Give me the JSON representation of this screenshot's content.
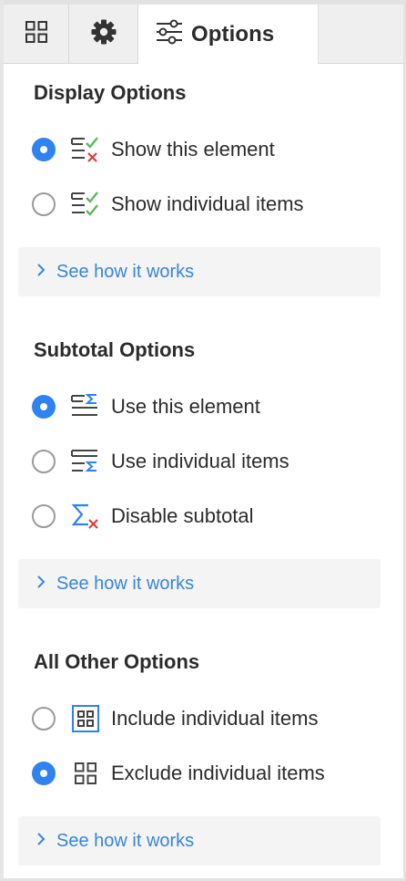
{
  "tabs": [
    {
      "name": "grid",
      "icon": "grid-icon"
    },
    {
      "name": "settings",
      "icon": "gear-icon"
    },
    {
      "name": "options",
      "icon": "sliders-icon",
      "label": "Options",
      "active": true
    }
  ],
  "sections": {
    "display": {
      "title": "Display Options",
      "options": [
        {
          "label": "Show this element",
          "icon": "list-check-x-icon",
          "checked": true
        },
        {
          "label": "Show individual items",
          "icon": "list-double-check-icon",
          "checked": false
        }
      ],
      "howto": "See how it works"
    },
    "subtotal": {
      "title": "Subtotal Options",
      "options": [
        {
          "label": "Use this element",
          "icon": "list-sigma-top-icon",
          "checked": true
        },
        {
          "label": "Use individual items",
          "icon": "list-sigma-bottom-icon",
          "checked": false
        },
        {
          "label": "Disable subtotal",
          "icon": "sigma-x-icon",
          "checked": false
        }
      ],
      "howto": "See how it works"
    },
    "other": {
      "title": "All Other Options",
      "options": [
        {
          "label": "Include individual items",
          "icon": "grid-boxed-icon",
          "checked": false
        },
        {
          "label": "Exclude individual items",
          "icon": "grid-icon",
          "checked": true
        }
      ],
      "howto": "See how it works"
    }
  },
  "colors": {
    "accent": "#2f82f0",
    "link": "#3a85d6",
    "check": "#5cb85c",
    "cross": "#e03b3b"
  }
}
